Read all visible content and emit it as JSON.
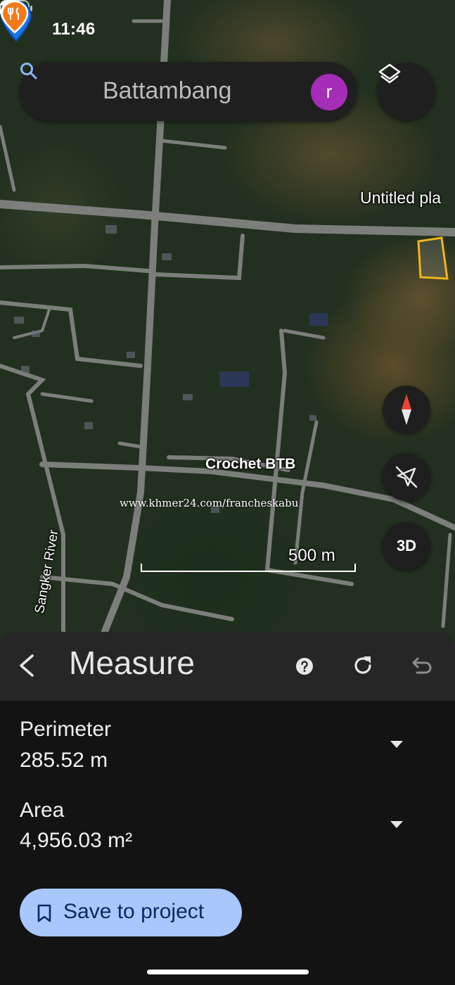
{
  "status_bar": {
    "time": "11:46"
  },
  "search": {
    "value": "Battambang"
  },
  "account": {
    "avatar_letter": "r",
    "avatar_color": "#a52db8"
  },
  "map": {
    "place_label": "Untitled pla",
    "poi_label": "Crochet BTB",
    "river_label": "Sangker River",
    "watermark": "www.khmer24.com/francheskabu",
    "scale_label": "500 m",
    "three_d_label": "3D",
    "polygon_color": "#f2b41c",
    "pin_color": "#1a73e8"
  },
  "measure": {
    "title": "Measure",
    "perimeter_label": "Perimeter",
    "perimeter_value": "285.52 m",
    "area_label": "Area",
    "area_value": "4,956.03 m²",
    "save_label": "Save to project"
  },
  "colors": {
    "panel_bg": "#131313",
    "header_bg": "#262626",
    "save_button_bg": "#a8c7fa"
  }
}
